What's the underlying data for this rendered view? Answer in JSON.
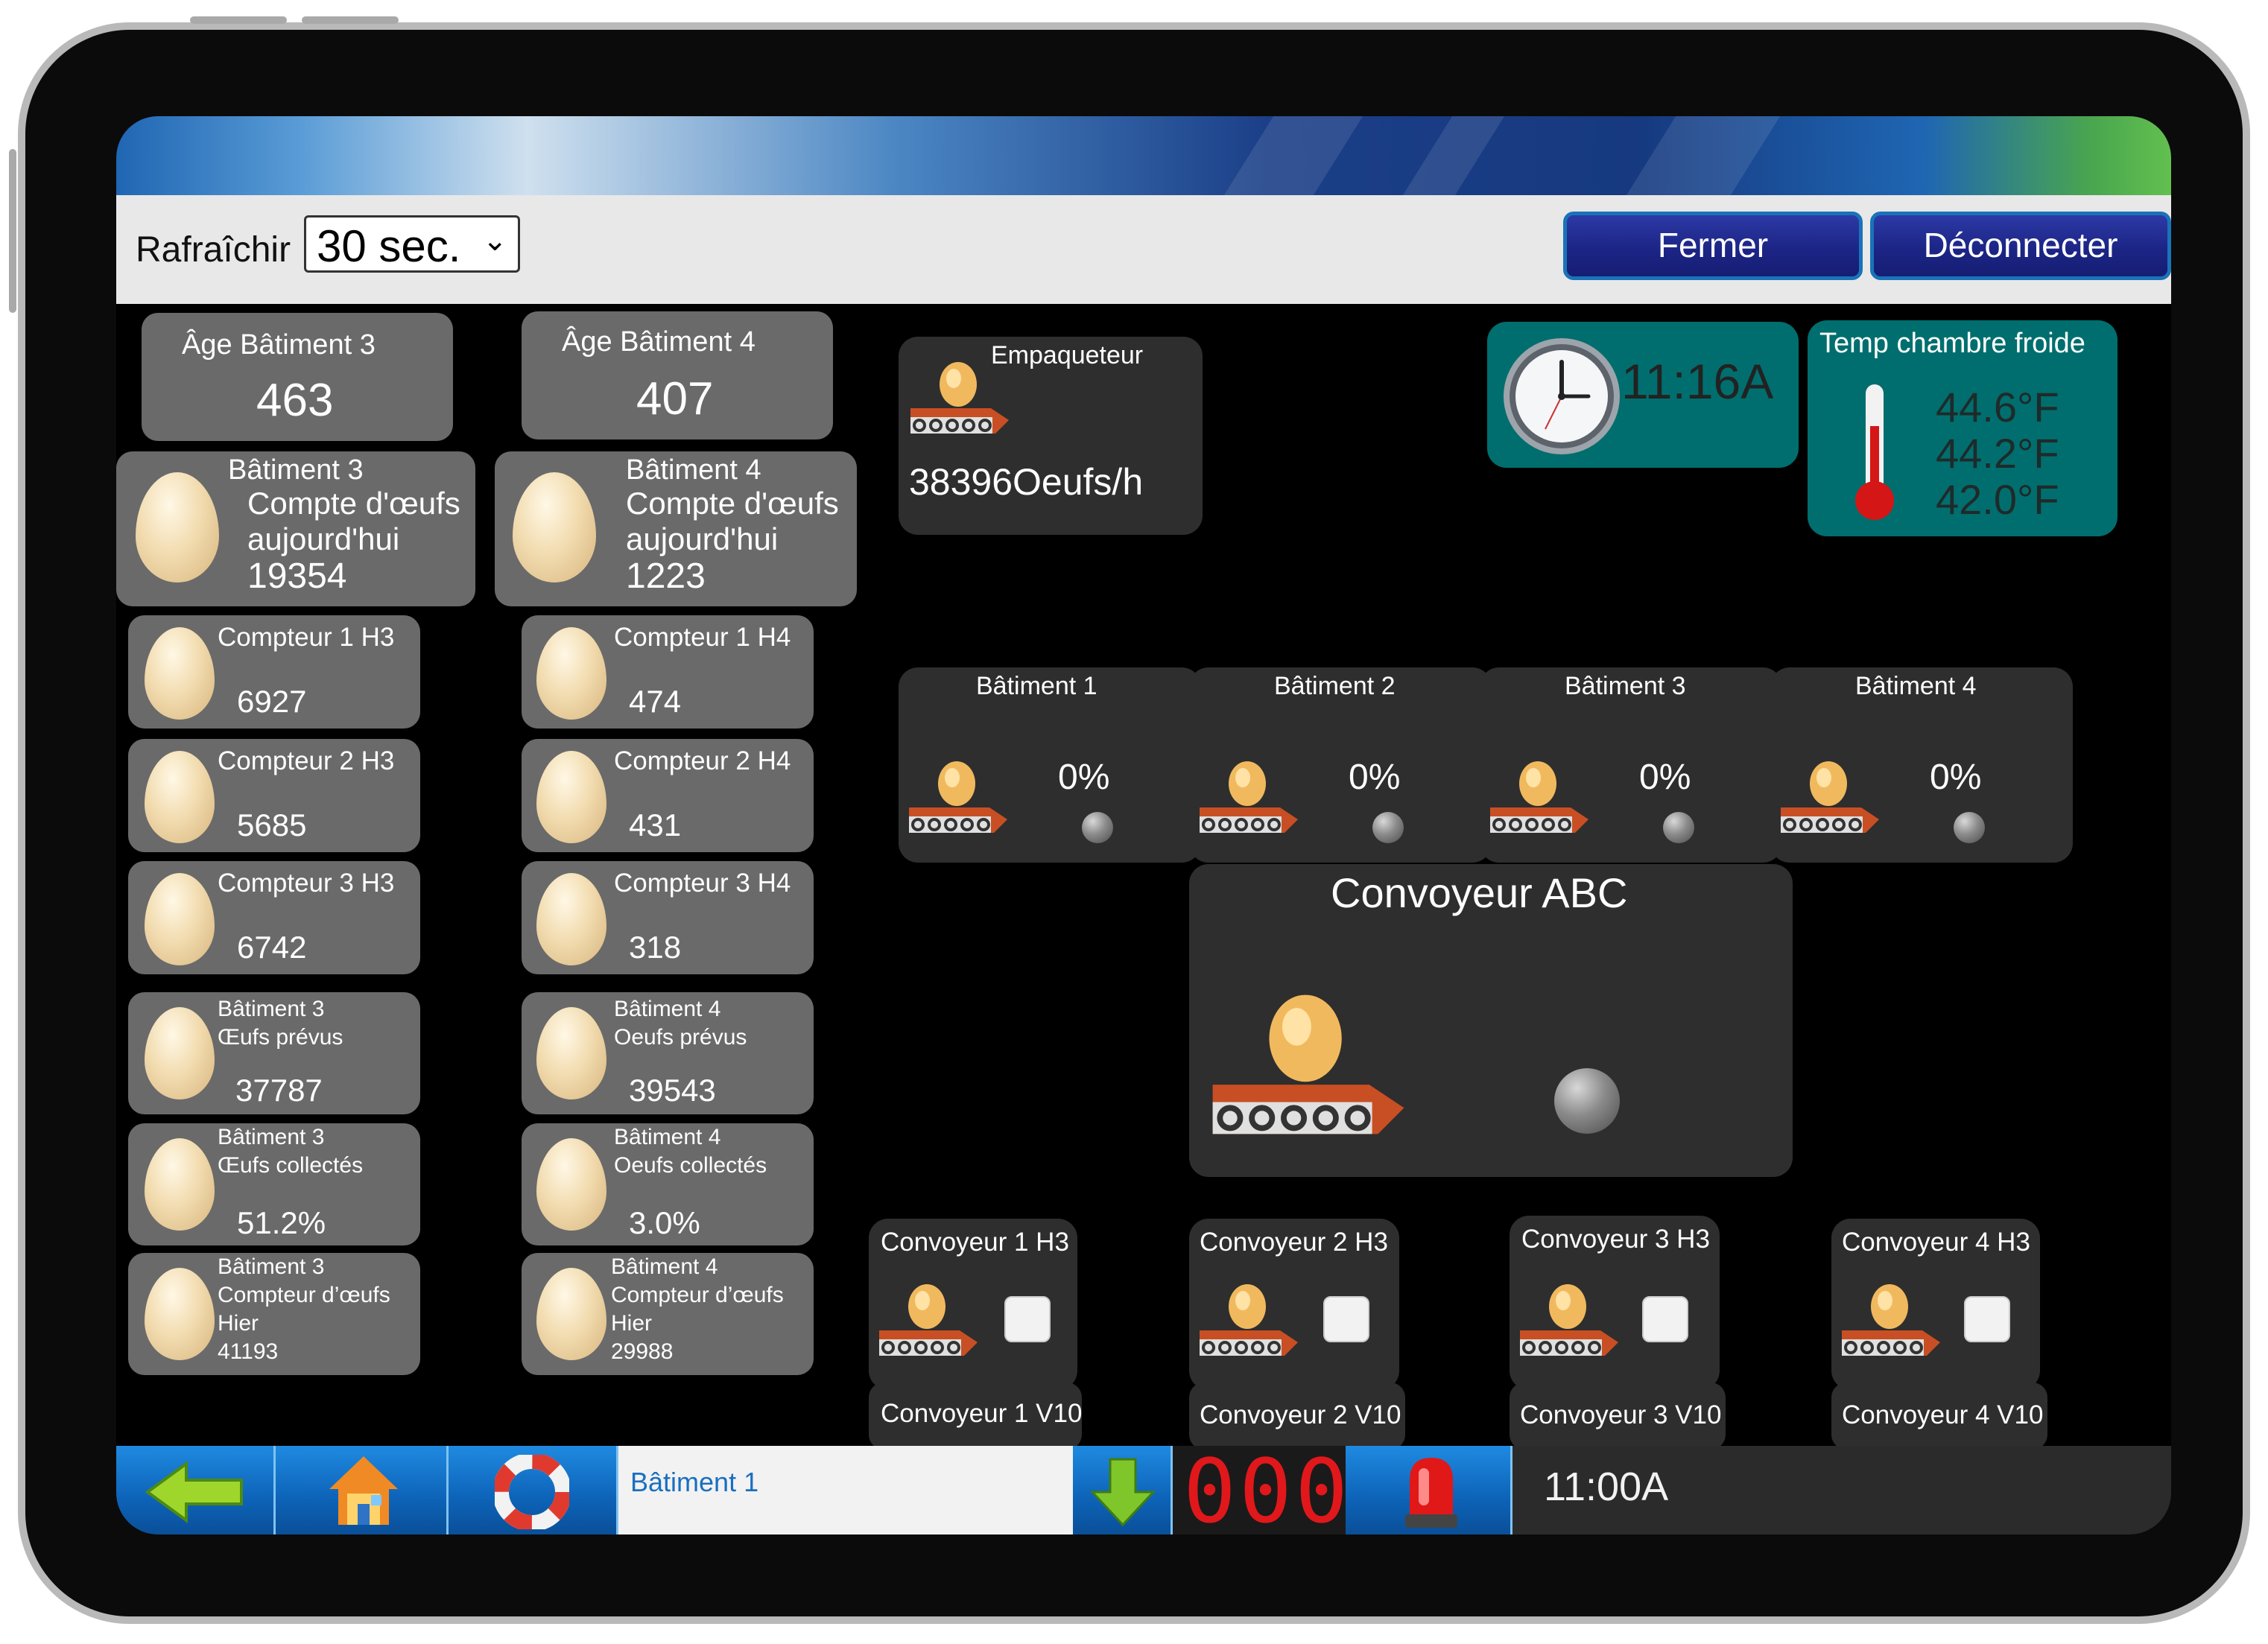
{
  "toolbar": {
    "refresh_label": "Rafraîchir",
    "refresh_value": "30 sec.",
    "close_label": "Fermer",
    "logout_label": "Déconnecter"
  },
  "age": [
    {
      "label": "Âge Bâtiment 3",
      "value": "463"
    },
    {
      "label": "Âge Bâtiment 4",
      "value": "407"
    }
  ],
  "today": [
    {
      "building": "Bâtiment 3",
      "line1": "Compte d'œufs",
      "line2": "aujourd'hui",
      "value": "19354"
    },
    {
      "building": "Bâtiment 4",
      "line1": "Compte d'œufs",
      "line2": "aujourd'hui",
      "value": "1223"
    }
  ],
  "counters_h3": [
    {
      "label": "Compteur 1 H3",
      "value": "6927"
    },
    {
      "label": "Compteur 2 H3",
      "value": "5685"
    },
    {
      "label": "Compteur 3 H3",
      "value": "6742"
    }
  ],
  "counters_h4": [
    {
      "label": "Compteur 1 H4",
      "value": "474"
    },
    {
      "label": "Compteur 2 H4",
      "value": "431"
    },
    {
      "label": "Compteur 3 H4",
      "value": "318"
    }
  ],
  "expected": [
    {
      "building": "Bâtiment 3",
      "label": "Œufs prévus",
      "value": "37787"
    },
    {
      "building": "Bâtiment 4",
      "label": "Oeufs prévus",
      "value": "39543"
    }
  ],
  "collected": [
    {
      "building": "Bâtiment 3",
      "label": "Œufs collectés",
      "value": "51.2%"
    },
    {
      "building": "Bâtiment 4",
      "label": "Oeufs collectés",
      "value": "3.0%"
    }
  ],
  "yesterday": [
    {
      "building": "Bâtiment 3",
      "line1": "Compteur d’œufs",
      "line2": "Hier",
      "value": "41193"
    },
    {
      "building": "Bâtiment 4",
      "line1": "Compteur d’œufs",
      "line2": "Hier",
      "value": "29988"
    }
  ],
  "packer": {
    "title": "Empaqueteur",
    "value": "38396Oeufs/h"
  },
  "clock": {
    "time": "11:16A"
  },
  "cold_room": {
    "title": "Temp chambre froide",
    "temps": [
      "44.6°F",
      "44.2°F",
      "42.0°F"
    ]
  },
  "buildings": [
    {
      "name": "Bâtiment 1",
      "percent": "0%"
    },
    {
      "name": "Bâtiment 2",
      "percent": "0%"
    },
    {
      "name": "Bâtiment 3",
      "percent": "0%"
    },
    {
      "name": "Bâtiment 4",
      "percent": "0%"
    }
  ],
  "conveyor_abc": {
    "title": "Convoyeur ABC"
  },
  "conveyors": [
    {
      "h3": "Convoyeur 1 H3",
      "v10": "Convoyeur 1 V10"
    },
    {
      "h3": "Convoyeur 2 H3",
      "v10": "Convoyeur 2 V10"
    },
    {
      "h3": "Convoyeur 3 H3",
      "v10": "Convoyeur 3 V10"
    },
    {
      "h3": "Convoyeur 4 H3",
      "v10": "Convoyeur 4 V10"
    }
  ],
  "bottombar": {
    "location": "Bâtiment 1",
    "counter": "000",
    "time": "11:00A"
  },
  "icons": {
    "back": "back-arrow-icon",
    "home": "home-icon",
    "help": "lifebuoy-icon",
    "download": "down-arrow-icon",
    "alarm": "alarm-light-icon"
  }
}
